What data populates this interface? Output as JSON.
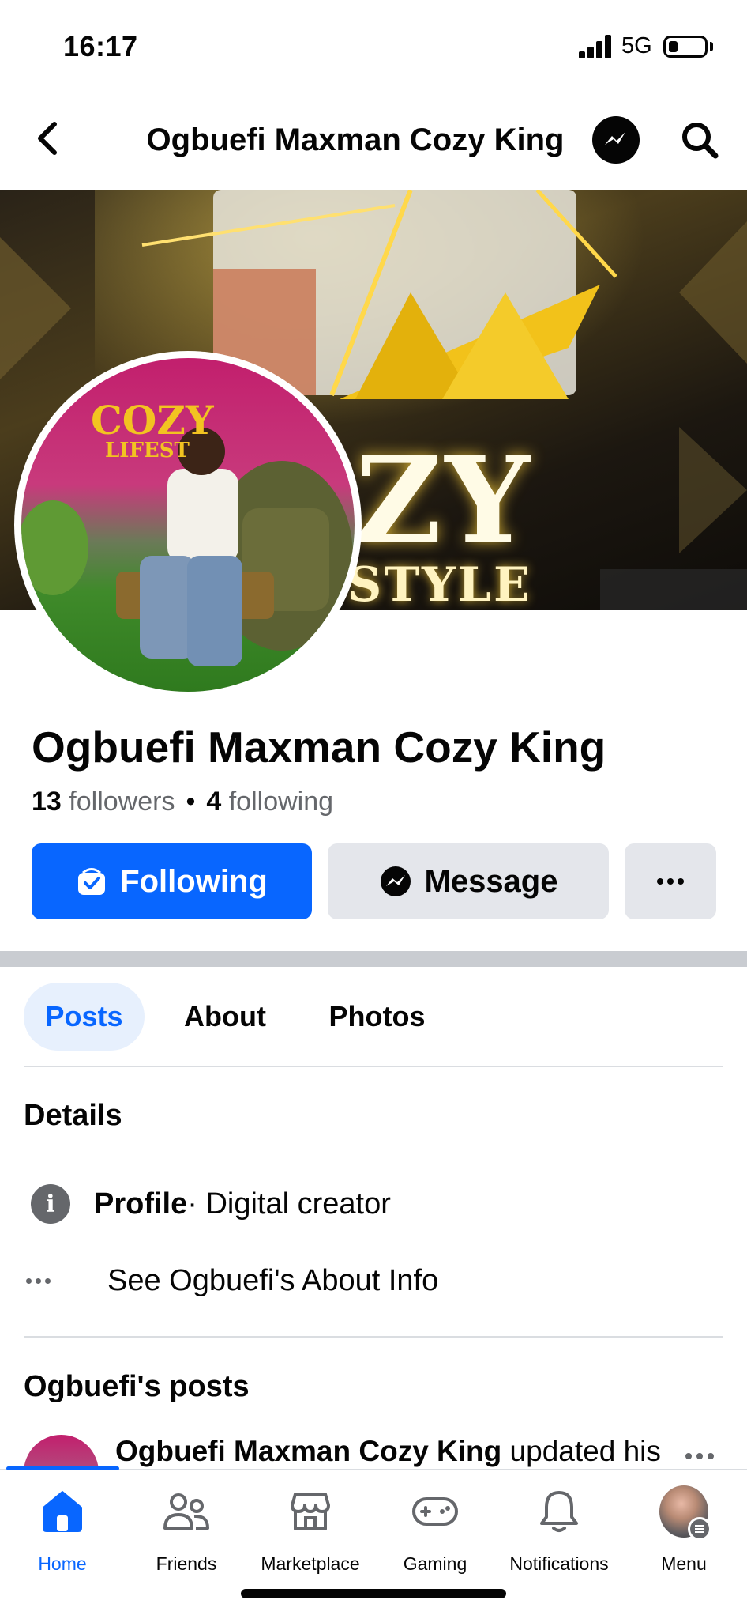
{
  "status_bar": {
    "time": "16:17",
    "network": "5G",
    "battery_level": 0.25
  },
  "header": {
    "title": "Ogbuefi Maxman Cozy King"
  },
  "cover": {
    "text_big": "ZY",
    "text_small": "STYLE"
  },
  "avatar_photo": {
    "text_main": "COZY",
    "text_sub": "LIFEST"
  },
  "profile": {
    "name": "Ogbuefi Maxman Cozy King",
    "followers_count": "13",
    "followers_label": "followers",
    "separator": "•",
    "following_count": "4",
    "following_label": "following"
  },
  "actions": {
    "following_label": "Following",
    "message_label": "Message"
  },
  "tabs": [
    {
      "label": "Posts",
      "selected": true
    },
    {
      "label": "About",
      "selected": false
    },
    {
      "label": "Photos",
      "selected": false
    }
  ],
  "details": {
    "title": "Details",
    "profile_label": "Profile",
    "profile_value": " · Digital creator",
    "about_link": "See Ogbuefi's About Info"
  },
  "posts": {
    "title": "Ogbuefi's posts",
    "first_author": "Ogbuefi Maxman Cozy King",
    "first_action": " updated his"
  },
  "bottom_nav": [
    {
      "label": "Home",
      "icon": "home-icon",
      "active": true
    },
    {
      "label": "Friends",
      "icon": "friends-icon",
      "active": false
    },
    {
      "label": "Marketplace",
      "icon": "marketplace-icon",
      "active": false
    },
    {
      "label": "Gaming",
      "icon": "gaming-icon",
      "active": false
    },
    {
      "label": "Notifications",
      "icon": "bell-icon",
      "active": false
    },
    {
      "label": "Menu",
      "icon": "menu-avatar",
      "active": false
    }
  ],
  "colors": {
    "primary": "#0866ff",
    "secondary_button": "#e4e6eb",
    "text": "#050505",
    "muted_text": "#65676b",
    "selected_tab_bg": "#e7f0fd"
  }
}
